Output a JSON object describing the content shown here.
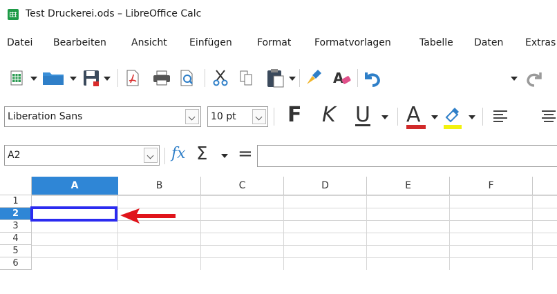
{
  "window": {
    "title": "Test Druckerei.ods – LibreOffice Calc",
    "app_icon": "calc-app-icon"
  },
  "menubar": {
    "items": [
      "Datei",
      "Bearbeiten",
      "Ansicht",
      "Einfügen",
      "Format",
      "Formatvorlagen",
      "Tabelle",
      "Daten",
      "Extras"
    ]
  },
  "toolbar_standard": {
    "icons": [
      "new-spreadsheet-icon",
      "open-folder-icon",
      "save-icon",
      "export-pdf-icon",
      "print-icon",
      "print-preview-icon",
      "cut-icon",
      "copy-icon",
      "paste-icon",
      "clone-formatting-icon",
      "clear-formatting-icon",
      "undo-icon",
      "redo-icon"
    ]
  },
  "toolbar_formatting": {
    "font_name": "Liberation Sans",
    "font_size": "10 pt",
    "bold": "F",
    "italic": "K",
    "underline": "U",
    "font_color_letter": "A",
    "font_color": "#d12a2a",
    "highlight_color": "#f2f20f"
  },
  "formula_bar": {
    "name_box": "A2",
    "function_wizard": "fx",
    "sum_symbol": "Σ",
    "equals": "=",
    "input_value": ""
  },
  "sheet": {
    "columns": [
      "A",
      "B",
      "C",
      "D",
      "E",
      "F"
    ],
    "rows": [
      "1",
      "2",
      "3",
      "4",
      "5",
      "6"
    ],
    "active_cell": "A2",
    "active_column": "A",
    "active_row": "2",
    "selection_color": "#2f86d6",
    "highlight_border_color": "#2b2bf0",
    "annotation_arrow_color": "#e0141b"
  }
}
